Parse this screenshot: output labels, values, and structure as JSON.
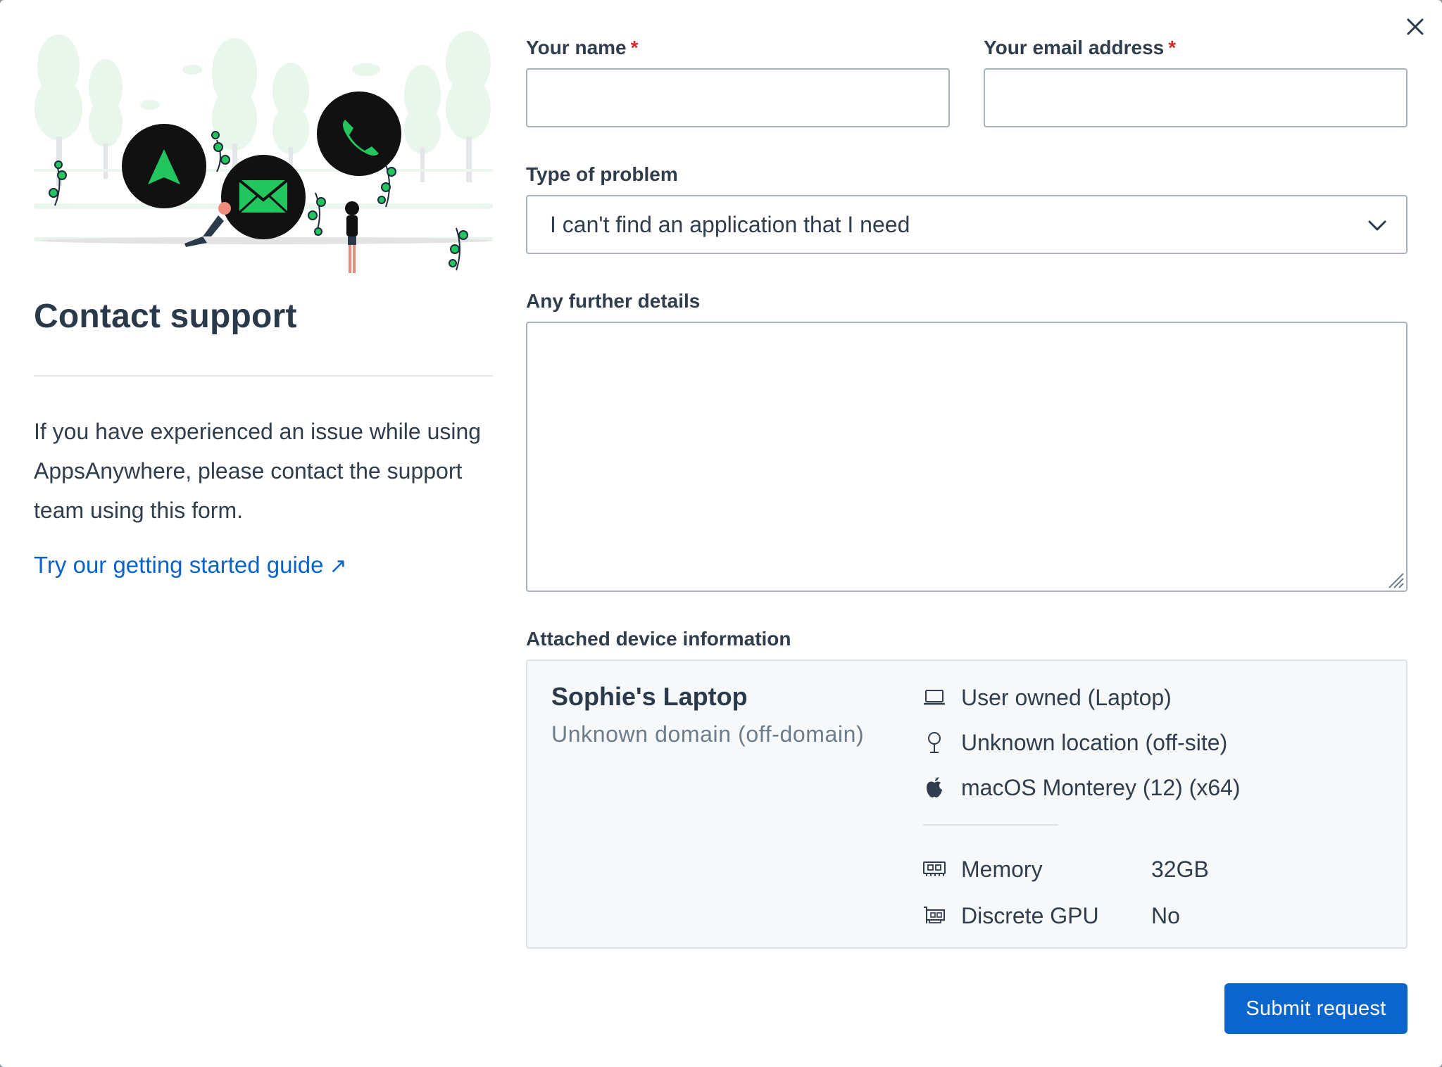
{
  "left": {
    "title": "Contact support",
    "intro": "If you have experienced an issue while using AppsAnywhere, please contact the support team using this form.",
    "guide_link": "Try our getting started guide",
    "guide_link_icon": "external-arrow-icon"
  },
  "form": {
    "name_label": "Your name",
    "email_label": "Your email address",
    "required_marker": "*",
    "name_value": "",
    "email_value": "",
    "problem_label": "Type of problem",
    "problem_selected": "I can't find an application that I need",
    "details_label": "Any further details",
    "details_value": "",
    "device_label": "Attached device information"
  },
  "device": {
    "name": "Sophie's Laptop",
    "domain": "Unknown domain (off-domain)",
    "ownership": "User owned (Laptop)",
    "location": "Unknown location (off-site)",
    "os": "macOS Monterey (12) (x64)",
    "specs": [
      {
        "label": "Memory",
        "value": "32GB",
        "icon": "memory-icon"
      },
      {
        "label": "Discrete GPU",
        "value": "No",
        "icon": "gpu-icon"
      }
    ]
  },
  "submit_label": "Submit request",
  "colors": {
    "accent": "#0a66cc",
    "link": "#0a63c9",
    "required": "#d22a2a",
    "illustration_green": "#22c55e"
  }
}
